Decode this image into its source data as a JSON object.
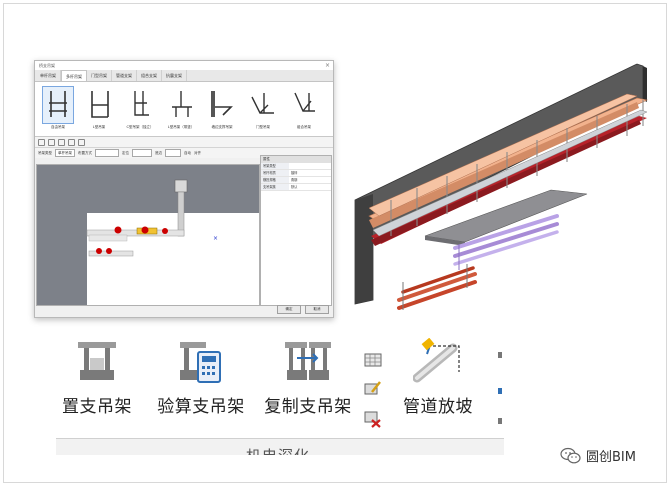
{
  "dialog": {
    "title": "桥支吊架",
    "close_glyph": "×",
    "tabs": [
      "单杆吊架",
      "多杆吊架",
      "门型吊架",
      "管道支架",
      "组合支架",
      "抗震支架"
    ],
    "active_tab_index": 1,
    "gallery": [
      {
        "label": "自由吊架"
      },
      {
        "label": "L型吊架"
      },
      {
        "label": "C型吊架（独立）"
      },
      {
        "label": "L型吊架（带竖）"
      },
      {
        "label": "墙边支撑吊架"
      },
      {
        "label": "门型吊架"
      },
      {
        "label": "组合吊架"
      }
    ],
    "params": {
      "type_label": "吊架类型",
      "type_value": "单杆吊架",
      "mode_label": "布置方式",
      "mode_value": "",
      "pos_label": "定位",
      "pos_value": "",
      "align_label": "底边",
      "align_value": "",
      "check1": "自动",
      "check2": "对齐"
    },
    "panel": {
      "header": "属性",
      "rows": [
        {
          "k": "吊架类型",
          "v": ""
        },
        {
          "k": "吊杆材质",
          "v": "镀锌"
        },
        {
          "k": "横担规格",
          "v": "角钢"
        },
        {
          "k": "支吊架族",
          "v": "默认"
        }
      ]
    },
    "buttons": {
      "ok": "确定",
      "cancel": "取消"
    }
  },
  "ribbon": {
    "buttons": [
      {
        "label": "置支吊架",
        "icon": "place-hanger-icon"
      },
      {
        "label": "验算支吊架",
        "icon": "check-hanger-icon"
      },
      {
        "label": "复制支吊架",
        "icon": "copy-hanger-icon"
      },
      {
        "label": "管道放坡",
        "icon": "pipe-slope-icon"
      }
    ],
    "group_label": "机电深化"
  },
  "watermark": {
    "text": "圆创BIM"
  },
  "colors": {
    "cable_tray": "#e8a77a",
    "wall": "#5a5a5a",
    "red_pipe": "#c0392b",
    "purple_pipe": "#a78bd6",
    "icon_blue": "#2f6fb5"
  }
}
